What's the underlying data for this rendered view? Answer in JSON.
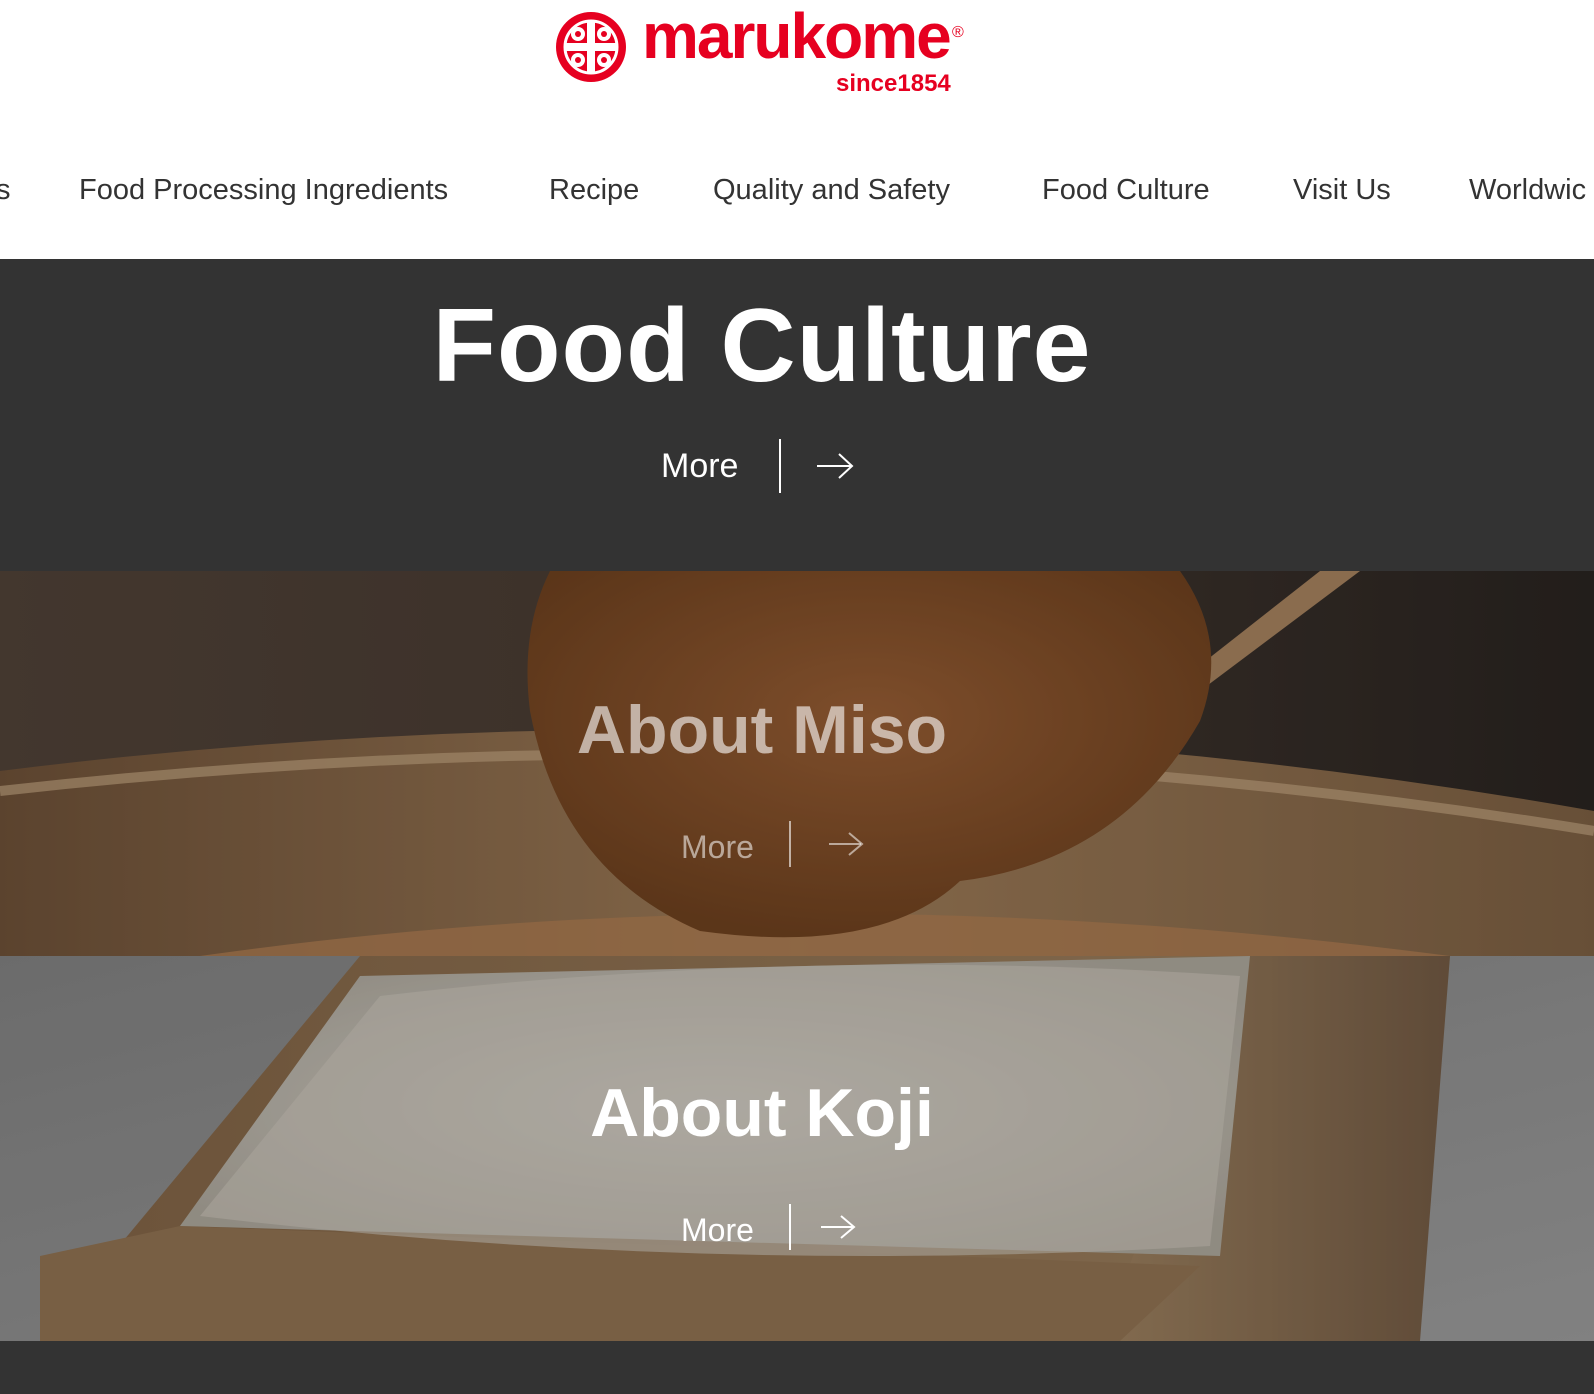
{
  "logo": {
    "word": "marukome",
    "registered": "®",
    "since": "since1854"
  },
  "nav": {
    "items": [
      {
        "label": "s"
      },
      {
        "label": "Food Processing Ingredients"
      },
      {
        "label": "Recipe"
      },
      {
        "label": "Quality and Safety"
      },
      {
        "label": "Food Culture"
      },
      {
        "label": "Visit Us"
      },
      {
        "label": "Worldwic"
      }
    ]
  },
  "hero": {
    "title": "Food Culture",
    "more_label": "More"
  },
  "panels": [
    {
      "title": "About Miso",
      "more_label": "More"
    },
    {
      "title": "About Koji",
      "more_label": "More"
    }
  ],
  "colors": {
    "brand": "#e60020",
    "dark": "#333333",
    "nav_text": "#333333"
  }
}
